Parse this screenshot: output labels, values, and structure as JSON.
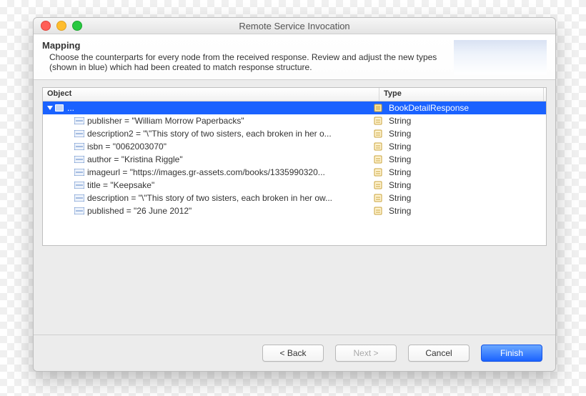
{
  "window": {
    "title": "Remote Service Invocation"
  },
  "header": {
    "title": "Mapping",
    "description": "Choose the counterparts for every node from the received response. Review and adjust the new types (shown in blue) which had been created to match response structure."
  },
  "table": {
    "columns": {
      "object": "Object",
      "type": "Type"
    },
    "root": {
      "label": "...",
      "type": "BookDetailResponse"
    },
    "rows": [
      {
        "label": "publisher = \"William Morrow Paperbacks\"",
        "type": "String"
      },
      {
        "label": "description2 = \"\\\"This story of two sisters, each broken in her o...",
        "type": "String"
      },
      {
        "label": "isbn = \"0062003070\"",
        "type": "String"
      },
      {
        "label": "author = \"Kristina Riggle\"",
        "type": "String"
      },
      {
        "label": "imageurl = \"https://images.gr-assets.com/books/1335990320...",
        "type": "String"
      },
      {
        "label": "title = \"Keepsake\"",
        "type": "String"
      },
      {
        "label": "description = \"\\\"This story of two sisters, each broken in her ow...",
        "type": "String"
      },
      {
        "label": "published = \"26 June 2012\"",
        "type": "String"
      }
    ]
  },
  "buttons": {
    "back": "< Back",
    "next": "Next >",
    "cancel": "Cancel",
    "finish": "Finish"
  }
}
